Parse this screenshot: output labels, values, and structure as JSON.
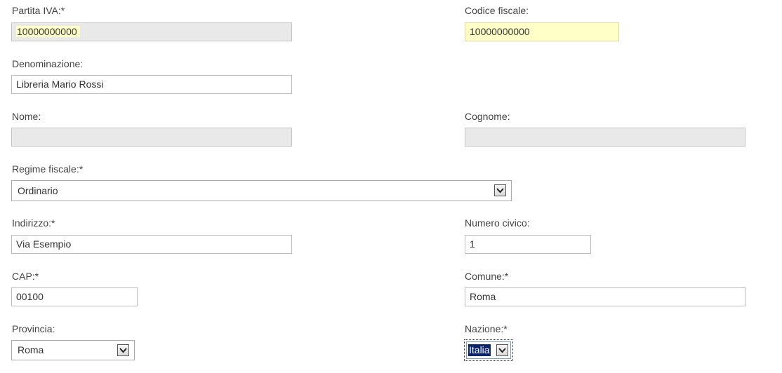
{
  "form": {
    "partita_iva": {
      "label": "Partita IVA:*",
      "value": "10000000000"
    },
    "codice_fiscale": {
      "label": "Codice fiscale:",
      "value": "10000000000"
    },
    "denominazione": {
      "label": "Denominazione:",
      "value": "Libreria Mario Rossi"
    },
    "nome": {
      "label": "Nome:",
      "value": ""
    },
    "cognome": {
      "label": "Cognome:",
      "value": ""
    },
    "regime_fiscale": {
      "label": "Regime fiscale:*",
      "value": "Ordinario"
    },
    "indirizzo": {
      "label": "Indirizzo:*",
      "value": "Via Esempio"
    },
    "numero_civico": {
      "label": "Numero civico:",
      "value": "1"
    },
    "cap": {
      "label": "CAP:*",
      "value": "00100"
    },
    "comune": {
      "label": "Comune:*",
      "value": "Roma"
    },
    "provincia": {
      "label": "Provincia:",
      "value": "Roma"
    },
    "nazione": {
      "label": "Nazione:*",
      "value": "Italia"
    }
  },
  "icons": {
    "dropdown": "chevron-down-icon"
  },
  "colors": {
    "autofill_yellow": "#ffffc7",
    "disabled_gray": "#e9e9e9",
    "selection_blue": "#0a246a"
  }
}
